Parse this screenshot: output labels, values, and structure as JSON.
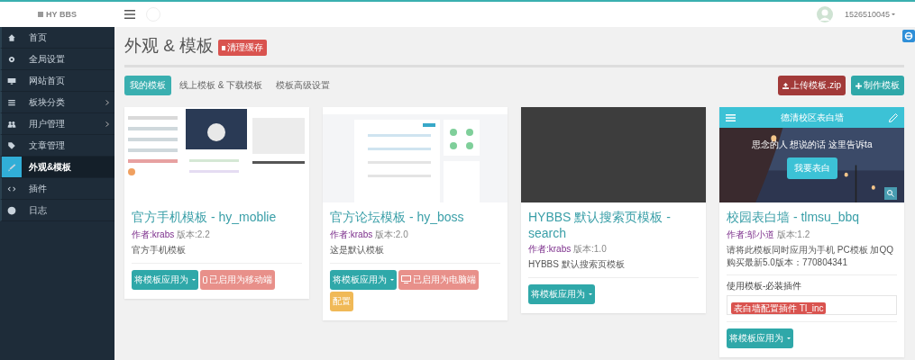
{
  "topbar": {
    "logo": "HY BBS",
    "username": "1526510045"
  },
  "sidebar": {
    "items": [
      {
        "label": "首页",
        "submenu": false,
        "selected": false
      },
      {
        "label": "全局设置",
        "submenu": false,
        "selected": false
      },
      {
        "label": "网站首页",
        "submenu": false,
        "selected": false
      },
      {
        "label": "板块分类",
        "submenu": true,
        "selected": false
      },
      {
        "label": "用户管理",
        "submenu": true,
        "selected": false
      },
      {
        "label": "文章管理",
        "submenu": false,
        "selected": false
      },
      {
        "label": "外观&模板",
        "submenu": false,
        "selected": true
      },
      {
        "label": "插件",
        "submenu": false,
        "selected": false
      },
      {
        "label": "日志",
        "submenu": false,
        "selected": false
      }
    ]
  },
  "page": {
    "title": "外观 & 模板",
    "badge": "清理缓存"
  },
  "tabs": [
    {
      "label": "我的模板",
      "selected": true
    },
    {
      "label": "线上模板 & 下载模板",
      "selected": false
    },
    {
      "label": "模板高级设置",
      "selected": false
    }
  ],
  "actions": [
    {
      "label": "上传模板.zip",
      "kind": "upload"
    },
    {
      "label": "制作模板",
      "kind": "create"
    }
  ],
  "templates": [
    {
      "name": "官方手机模板 - hy_moblie",
      "author": "作者:krabs",
      "version": "版本:2.2",
      "description": "官方手机模板",
      "buttons": [
        {
          "label": "将模板应用为",
          "kind": "apply"
        },
        {
          "label": "已启用为移动端",
          "kind": "mobile"
        }
      ]
    },
    {
      "name": "官方论坛模板 - hy_boss",
      "author": "作者:krabs",
      "version": "版本:2.0",
      "description": "这是默认模板",
      "buttons": [
        {
          "label": "将模板应用为",
          "kind": "apply"
        },
        {
          "label": "已启用为电脑端",
          "kind": "pc"
        },
        {
          "label": "配置",
          "kind": "config"
        }
      ]
    },
    {
      "name": "HYBBS 默认搜索页模板 - search",
      "author": "作者:krabs",
      "version": "版本:1.0",
      "description": "HYBBS 默认搜索页模板",
      "buttons": [
        {
          "label": "将模板应用为",
          "kind": "apply"
        }
      ]
    },
    {
      "preview": {
        "title": "德清校区表白墙",
        "slogan": "思念的人 想说的话 这里告诉ta",
        "button": "我要表白"
      },
      "name": "校园表白墙 - tlmsu_bbq",
      "author": "作者:邬小道",
      "version": "版本:1.2",
      "description": "请将此模板同时应用为手机 PC模板 加QQ购买最新5.0版本：770804341",
      "plugins_title": "使用模板-必装插件",
      "plugins": [
        "表白墙配置插件 Tl_inc"
      ],
      "buttons": [
        {
          "label": "将模板应用为",
          "kind": "apply"
        }
      ]
    }
  ]
}
